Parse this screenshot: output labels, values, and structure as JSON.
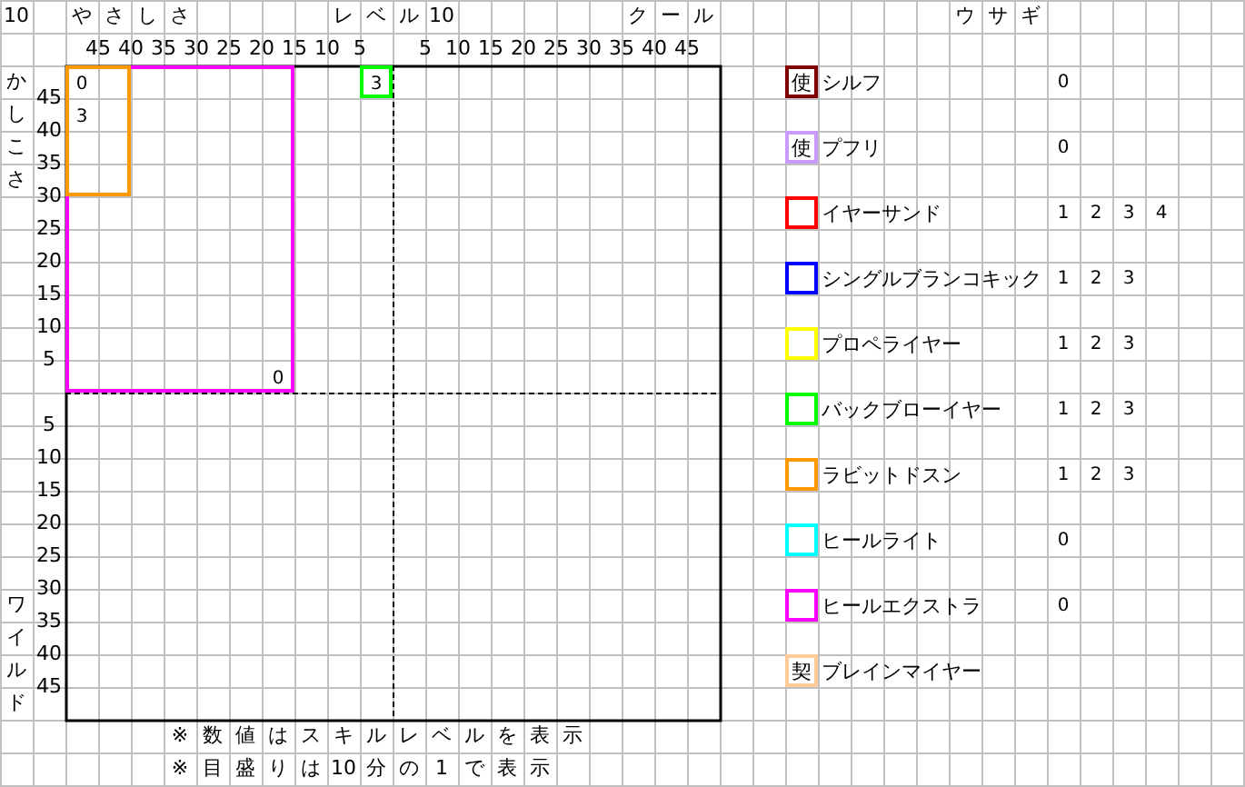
{
  "corner_label": "10",
  "x_axis": {
    "left_title": "やさしさ",
    "center_title": "レベル 10",
    "right_title": "クール",
    "left_ticks": [
      "45",
      "40",
      "35",
      "30",
      "25",
      "20",
      "15",
      "10",
      "5"
    ],
    "right_ticks": [
      "5",
      "10",
      "15",
      "20",
      "25",
      "30",
      "35",
      "40",
      "45"
    ]
  },
  "y_axis": {
    "top_title": "かしこさ",
    "bottom_title": "ワイルド",
    "top_ticks": [
      "45",
      "40",
      "35",
      "30",
      "25",
      "20",
      "15",
      "10",
      "5"
    ],
    "bottom_ticks": [
      "5",
      "10",
      "15",
      "20",
      "25",
      "30",
      "35",
      "40",
      "45"
    ]
  },
  "regions": [
    {
      "color": "#ff00ff"
    },
    {
      "color": "#ff9900"
    },
    {
      "color": "#00ff00"
    }
  ],
  "value_labels": [
    "0",
    "3",
    "3",
    "0"
  ],
  "notes": [
    "※数値はスキルレベルを表示",
    "※目盛りは 10 分の 1 で表示"
  ],
  "legend": {
    "title": "ウサギ",
    "skills": [
      {
        "name": "シルフ",
        "color": "#800000",
        "badge": "使",
        "levels": [
          "0"
        ]
      },
      {
        "name": "プフリ",
        "color": "#cc99ff",
        "badge": "使",
        "levels": [
          "0"
        ]
      },
      {
        "name": "イヤーサンド",
        "color": "#ff0000",
        "levels": [
          "1",
          "2",
          "3",
          "4"
        ]
      },
      {
        "name": "シングルブランコキック",
        "color": "#0000ff",
        "levels": [
          "1",
          "2",
          "3"
        ]
      },
      {
        "name": "プロペライヤー",
        "color": "#ffff00",
        "levels": [
          "1",
          "2",
          "3"
        ]
      },
      {
        "name": "バックブローイヤー",
        "color": "#00ff00",
        "levels": [
          "1",
          "2",
          "3"
        ]
      },
      {
        "name": "ラビットドスン",
        "color": "#ff9900",
        "levels": [
          "1",
          "2",
          "3"
        ]
      },
      {
        "name": "ヒールライト",
        "color": "#00ffff",
        "levels": [
          "0"
        ]
      },
      {
        "name": "ヒールエクストラ",
        "color": "#ff00ff",
        "levels": [
          "0"
        ]
      },
      {
        "name": "ブレインマイヤー",
        "color": "#ffcc99",
        "badge": "契"
      }
    ]
  }
}
